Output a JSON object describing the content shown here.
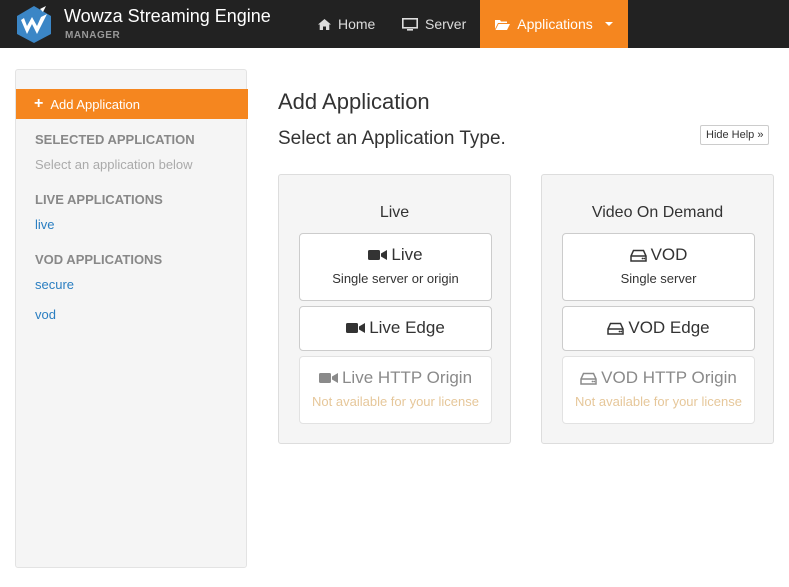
{
  "header": {
    "brand_title": "Wowza Streaming Engine",
    "brand_subtitle": "MANAGER",
    "nav": {
      "home": "Home",
      "server": "Server",
      "applications": "Applications"
    },
    "accent_color": "#f5861f"
  },
  "sidebar": {
    "add_button": "Add Application",
    "selected_heading": "SELECTED APPLICATION",
    "selected_hint": "Select an application below",
    "live_heading": "LIVE APPLICATIONS",
    "live_items": [
      "live"
    ],
    "vod_heading": "VOD APPLICATIONS",
    "vod_items": [
      "secure",
      "vod"
    ]
  },
  "main": {
    "title": "Add Application",
    "subtitle": "Select an Application Type.",
    "hide_help": "Hide Help »",
    "live_panel": {
      "title": "Live",
      "options": [
        {
          "label": "Live",
          "desc": "Single server or origin",
          "icon": "video-camera-icon"
        },
        {
          "label": "Live Edge",
          "icon": "video-camera-icon"
        },
        {
          "label": "Live HTTP Origin",
          "desc": "Not available for your license",
          "icon": "video-camera-icon",
          "disabled": true
        }
      ]
    },
    "vod_panel": {
      "title": "Video On Demand",
      "options": [
        {
          "label": "VOD",
          "desc": "Single server",
          "icon": "hard-drive-icon"
        },
        {
          "label": "VOD Edge",
          "icon": "hard-drive-icon"
        },
        {
          "label": "VOD HTTP Origin",
          "desc": "Not available for your license",
          "icon": "hard-drive-icon",
          "disabled": true
        }
      ]
    }
  }
}
